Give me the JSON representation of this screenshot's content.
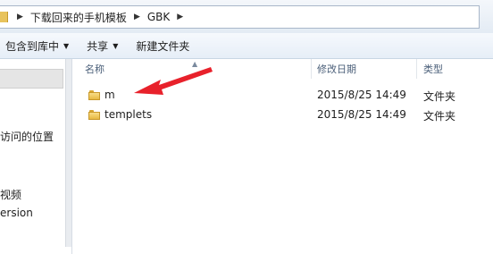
{
  "address_bar": {
    "crumbs": [
      "下载回来的手机模板",
      "GBK"
    ]
  },
  "toolbar": {
    "include_label": "包含到库中",
    "share_label": "共享",
    "new_folder_label": "新建文件夹"
  },
  "nav_pane": {
    "items": [
      "访问的位置",
      "视频",
      "ersion"
    ]
  },
  "columns": {
    "name": "名称",
    "date": "修改日期",
    "type": "类型"
  },
  "files": [
    {
      "name": "m",
      "date": "2015/8/25 14:49",
      "type": "文件夹"
    },
    {
      "name": "templets",
      "date": "2015/8/25 14:49",
      "type": "文件夹"
    }
  ],
  "colors": {
    "arrow": "#e8212b",
    "column_header_text": "#4c607a"
  },
  "icons": [
    "folder-icon",
    "chevron-right-icon",
    "dropdown-arrow-icon",
    "sort-up-icon",
    "red-arrow-annotation"
  ]
}
